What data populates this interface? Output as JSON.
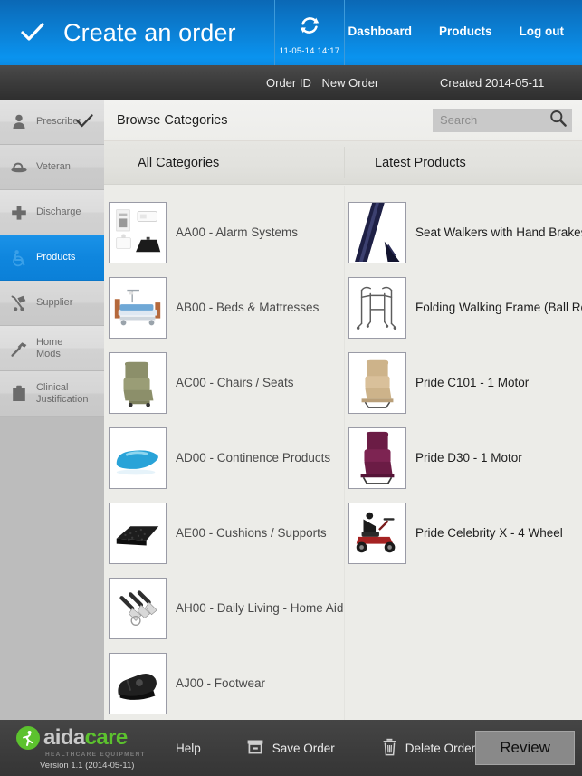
{
  "header": {
    "title": "Create an order",
    "check_icon": "check-icon",
    "refresh_icon": "refresh-icon",
    "refresh_time": "11-05-14 14:17",
    "nav": [
      {
        "label": "Dashboard",
        "name": "nav-dashboard"
      },
      {
        "label": "Products",
        "name": "nav-products"
      },
      {
        "label": "Log out",
        "name": "nav-logout"
      }
    ]
  },
  "orderbar": {
    "order_id_label": "Order ID",
    "order_id_value": "New Order",
    "created_text": "Created 2014-05-11"
  },
  "sidebar": {
    "items": [
      {
        "label": "Prescriber",
        "icon": "person-icon",
        "active": false,
        "checked": true
      },
      {
        "label": "Veteran",
        "icon": "hat-icon",
        "active": false,
        "checked": false
      },
      {
        "label": "Discharge",
        "icon": "medical-cross-icon",
        "active": false,
        "checked": false
      },
      {
        "label": "Products",
        "icon": "wheelchair-icon",
        "active": true,
        "checked": false
      },
      {
        "label": "Supplier",
        "icon": "hand-truck-icon",
        "active": false,
        "checked": false
      },
      {
        "label": "Home\nMods",
        "icon": "hammer-icon",
        "active": false,
        "checked": false
      },
      {
        "label": "Clinical\nJustification",
        "icon": "clipboard-icon",
        "active": false,
        "checked": false
      }
    ]
  },
  "browse": {
    "title": "Browse Categories",
    "search_placeholder": "Search",
    "search_value": "",
    "search_icon": "magnifier-icon",
    "column_headers": {
      "categories": "All Categories",
      "products": "Latest Products"
    }
  },
  "categories": [
    {
      "label": "AA00 - Alarm Systems",
      "thumb": "alarm-systems-thumb"
    },
    {
      "label": "AB00 - Beds & Mattresses",
      "thumb": "bed-thumb"
    },
    {
      "label": "AC00 - Chairs / Seats",
      "thumb": "recliner-chair-thumb"
    },
    {
      "label": "AD00 - Continence Products",
      "thumb": "continence-thumb"
    },
    {
      "label": "AE00 - Cushions / Supports",
      "thumb": "cushion-thumb"
    },
    {
      "label": "AH00 - Daily Living - Home Aid",
      "thumb": "cutlery-thumb"
    },
    {
      "label": "AJ00 - Footwear",
      "thumb": "footwear-thumb"
    }
  ],
  "latest_products": [
    {
      "label": "Seat Walkers with Hand Brakes",
      "thumb": "seat-walker-thumb"
    },
    {
      "label": "Folding Walking Frame (Ball Re",
      "thumb": "walking-frame-thumb"
    },
    {
      "label": "Pride C101 - 1 Motor",
      "thumb": "lift-chair-tan-thumb"
    },
    {
      "label": "Pride D30 - 1 Motor",
      "thumb": "lift-chair-purple-thumb"
    },
    {
      "label": "Pride Celebrity X - 4 Wheel",
      "thumb": "scooter-thumb"
    }
  ],
  "footer": {
    "logo_primary": "aida",
    "logo_secondary": "care",
    "logo_tagline": "HEALTHCARE EQUIPMENT",
    "version": "Version 1.1 (2014-05-11)",
    "help_label": "Help",
    "save_label": "Save Order",
    "save_icon": "archive-box-icon",
    "delete_label": "Delete Order",
    "delete_icon": "trash-icon",
    "review_label": "Review"
  },
  "colors": {
    "accent_blue": "#0b86dd",
    "brand_green": "#5cc22e",
    "sidebar_bg": "#bcbcbc",
    "footer_bg": "#3d3d3d"
  }
}
